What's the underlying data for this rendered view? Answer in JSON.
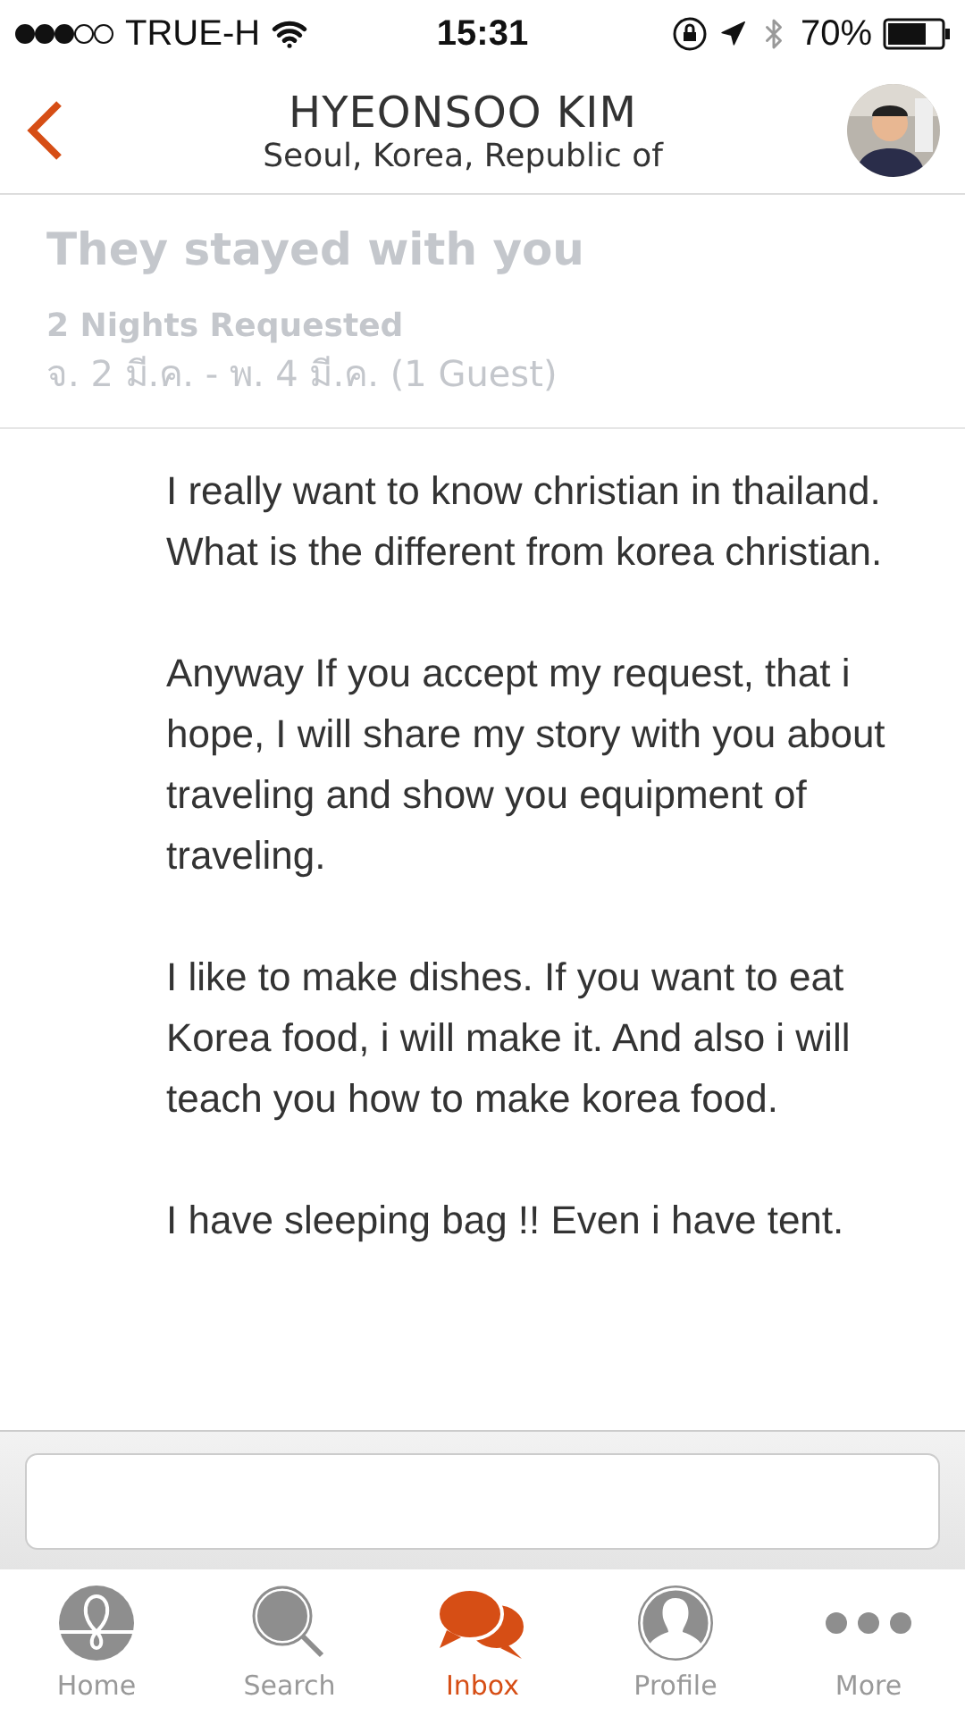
{
  "status_bar": {
    "carrier": "TRUE-H",
    "time": "15:31",
    "battery": "70%"
  },
  "header": {
    "title": "HYEONSOO KIM",
    "subtitle": "Seoul, Korea, Republic of"
  },
  "request": {
    "heading": "They stayed with you",
    "nights": "2 Nights Requested",
    "dates": "จ. 2 มี.ค. - พ. 4 มี.ค. (1 Guest)"
  },
  "message": {
    "paragraphs": [
      "I really want to know christian in thailand.\nWhat is the different from korea christian.",
      "Anyway If you accept my request, that i hope, I will share my story with you about traveling and show you equipment of traveling.",
      "I like to make dishes. If you want to eat Korea food, i will make it. And also i will teach you how to make korea food.",
      "I have sleeping bag !! Even i have tent."
    ]
  },
  "tabs": [
    {
      "label": "Home",
      "selected": false
    },
    {
      "label": "Search",
      "selected": false
    },
    {
      "label": "Inbox",
      "selected": true
    },
    {
      "label": "Profile",
      "selected": false
    },
    {
      "label": "More",
      "selected": false
    }
  ]
}
